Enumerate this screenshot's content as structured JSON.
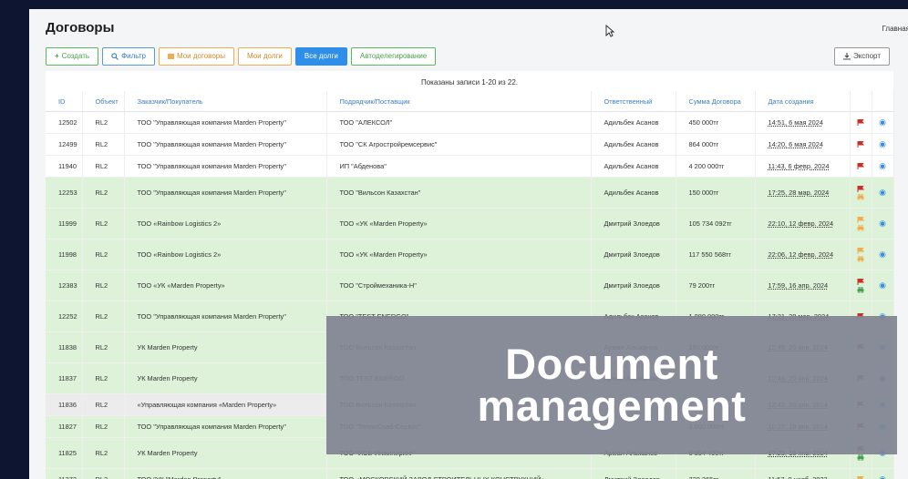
{
  "header": {
    "title": "Договоры",
    "breadcrumb": "Главная"
  },
  "toolbar": {
    "create": "Создать",
    "filter": "Фильтр",
    "my_contracts": "Мои договоры",
    "my_debts": "Мои долги",
    "all_debts": "Все долги",
    "autodelegation": "Автоделегирование",
    "export": "Экспорт"
  },
  "summary": "Показаны записи 1-20 из 22.",
  "columns": {
    "id": "ID",
    "object": "Объект",
    "customer": "Заказчик/Покупатель",
    "contractor": "Подрядчик/Поставщик",
    "responsible": "Ответственный",
    "amount": "Сумма Договора",
    "created": "Дата создания"
  },
  "rows": [
    {
      "id": "12502",
      "object": "RL2",
      "customer": "ТОО \"Управляющая компания Marden Property\"",
      "contractor": "ТОО \"АЛЕКСОЛ\"",
      "responsible": "Адильбек Асанов",
      "amount": "450 000тг",
      "created": "14:51, 6 мая 2024",
      "style": "white",
      "icons": [
        "flag-red"
      ]
    },
    {
      "id": "12499",
      "object": "RL2",
      "customer": "ТОО \"Управляющая компания Marden Property\"",
      "contractor": "ТОО \"СК Агростройремсервис\"",
      "responsible": "Адильбек Асанов",
      "amount": "864 000тг",
      "created": "14:20, 6 мая 2024",
      "style": "white",
      "icons": [
        "flag-red"
      ]
    },
    {
      "id": "11940",
      "object": "RL2",
      "customer": "ТОО \"Управляющая компания Marden Property\"",
      "contractor": "ИП \"Абденова\"",
      "responsible": "Адильбек Асанов",
      "amount": "4 200 000тг",
      "created": "11:43, 6 февр. 2024",
      "style": "white",
      "icons": [
        "flag-red"
      ]
    },
    {
      "id": "12253",
      "object": "RL2",
      "customer": "ТОО \"Управляющая компания Marden Property\"",
      "contractor": "ТОО \"Вильсон Казахстан\"",
      "responsible": "Адильбек Асанов",
      "amount": "150 000тг",
      "created": "17:25, 28 мар. 2024",
      "style": "green-tall",
      "icons": [
        "flag-red",
        "print-orange"
      ]
    },
    {
      "id": "11999",
      "object": "RL2",
      "customer": "ТОО «Rainbow Logistics 2»",
      "contractor": "ТОО «УК «Marden Property»",
      "responsible": "Дмитрий Злоедов",
      "amount": "105 734 092тг",
      "created": "22:10, 12 февр. 2024",
      "style": "green-tall",
      "icons": [
        "flag-orange",
        "print-orange"
      ]
    },
    {
      "id": "11998",
      "object": "RL2",
      "customer": "ТОО «Rainbow Logistics 2»",
      "contractor": "ТОО «УК «Marden Property»",
      "responsible": "Дмитрий Злоедов",
      "amount": "117 550 568тг",
      "created": "22:06, 12 февр. 2024",
      "style": "green-tall",
      "icons": [
        "flag-orange",
        "print-orange"
      ]
    },
    {
      "id": "12383",
      "object": "RL2",
      "customer": "ТОО «УК «Marden Property»",
      "contractor": "ТОО \"Строймеханика-Н\"",
      "responsible": "Дмитрий Злоедов",
      "amount": "79 200тг",
      "created": "17:59, 16 апр. 2024",
      "style": "green-tall",
      "icons": [
        "flag-red",
        "print-green"
      ]
    },
    {
      "id": "12252",
      "object": "RL2",
      "customer": "ТОО \"Управляющая компания Marden Property\"",
      "contractor": "ТОО \"TEST ENERGO\"",
      "responsible": "Адильбек Асанов",
      "amount": "1 080 000тг",
      "created": "17:21, 28 мар. 2024",
      "style": "green-tall",
      "icons": [
        "flag-red"
      ]
    },
    {
      "id": "11838",
      "object": "RL2",
      "customer": "УК Marden Property",
      "contractor": "ТОО Вильсон Казахстан",
      "responsible": "Арман Альжанов",
      "amount": "150 000тг",
      "created": "12:49, 20 янв. 2024",
      "style": "green-tall",
      "icons": [
        "flag-red"
      ]
    },
    {
      "id": "11837",
      "object": "RL2",
      "customer": "УК Marden Property",
      "contractor": "ТОО TEST ENERGO",
      "responsible": "Арман Альжанов",
      "amount": "",
      "created": "12:46, 20 янв. 2024",
      "style": "green-tall",
      "icons": [
        "flag-red"
      ]
    },
    {
      "id": "11836",
      "object": "RL2",
      "customer": "«Управляющая компания «Marden Property»",
      "contractor": "ТОО Вильсон Казахстан",
      "responsible": "",
      "amount": "",
      "created": "12:42, 20 янв. 2024",
      "style": "gray",
      "icons": [
        "flag-red"
      ]
    },
    {
      "id": "11827",
      "object": "RL2",
      "customer": "ТОО \"Управляющая компания Marden Property\"",
      "contractor": "ТОО \"ТеплоСнаб-Сервис\"",
      "responsible": "",
      "amount": "3 000 000тг",
      "created": "10:27, 19 янв. 2024",
      "style": "green",
      "icons": [
        "flag-red"
      ]
    },
    {
      "id": "11825",
      "object": "RL2",
      "customer": "УК Marden Property",
      "contractor": "ТОО \"ИСБ-Инжиниринг\"",
      "responsible": "Арман Альжанов",
      "amount": "6 854 400тг",
      "created": "17:25, 18 янв. 2024",
      "style": "green-tall",
      "icons": [
        "flag-red",
        "print-green"
      ]
    },
    {
      "id": "11372",
      "object": "RL2",
      "customer": "ТОО \"УК \"Marden Property\"",
      "contractor": "ТОО «МОСКОВСКИЙ ЗАВОД СТРОИТЕЛЬНЫХ КОНСТРУКЦИЙ»",
      "responsible": "Дмитрий Злоедов",
      "amount": "738 365тг",
      "created": "11:57, 9 нояб. 2023",
      "style": "green",
      "icons": [
        "flag-orange"
      ]
    }
  ],
  "overlay": {
    "line1": "Document",
    "line2": "management"
  },
  "colors": {
    "green_row": "#ddf2d9",
    "accent": "#2f8ee8",
    "flag_red": "#c9302c",
    "flag_orange": "#f0ad4e"
  }
}
